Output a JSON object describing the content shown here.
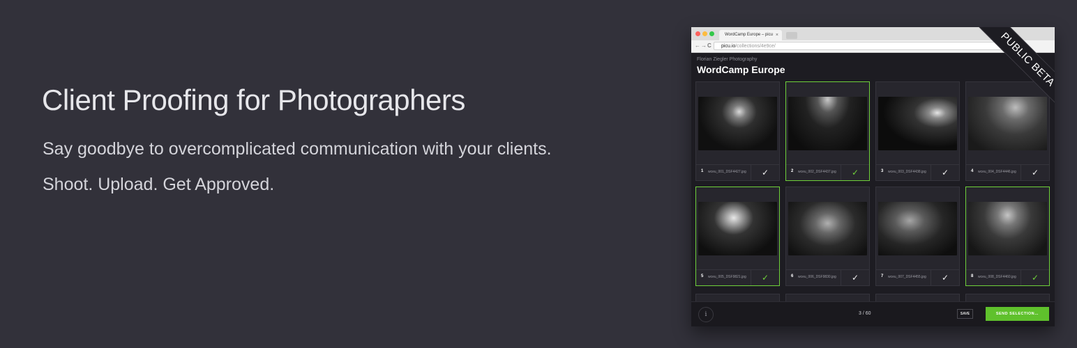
{
  "hero": {
    "title": "Client Proofing for Photographers",
    "subtitle": "Say goodbye to overcomplicated communication with your clients.",
    "tagline": "Shoot. Upload. Get Approved."
  },
  "browser": {
    "tab_title": "WordCamp Europe – picu",
    "tab_close": "×",
    "url_host": "picu.io",
    "url_path": "/collections/4e9ce/",
    "back_icon": "←",
    "forward_icon": "→",
    "reload_icon": "C"
  },
  "app": {
    "photographer": "Florian Ziegler Photography",
    "collection_title": "WordCamp Europe",
    "ribbon": "PUBLIC BETA",
    "info_icon": "i",
    "page_count": "3 / 60",
    "save_label": "SAVE",
    "send_label": "SEND SELECTION…"
  },
  "photos": [
    {
      "num": "1",
      "file": "wceu_001_DSF4427.jpg",
      "selected": false
    },
    {
      "num": "2",
      "file": "wceu_002_DSF4437.jpg",
      "selected": true
    },
    {
      "num": "3",
      "file": "wceu_003_DSF4438.jpg",
      "selected": false
    },
    {
      "num": "4",
      "file": "wceu_004_DSF4446.jpg",
      "selected": false
    },
    {
      "num": "5",
      "file": "wceu_005_DSF9821.jpg",
      "selected": true
    },
    {
      "num": "6",
      "file": "wceu_006_DSF9830.jpg",
      "selected": false
    },
    {
      "num": "7",
      "file": "wceu_007_DSF4455.jpg",
      "selected": false
    },
    {
      "num": "8",
      "file": "wceu_008_DSF4460.jpg",
      "selected": true
    }
  ],
  "check_glyph": "✓",
  "colors": {
    "background": "#32313a",
    "accent_green": "#5fc12c",
    "selected_border": "#6fd13a"
  }
}
